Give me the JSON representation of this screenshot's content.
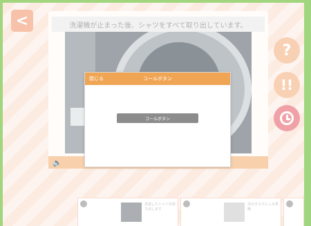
{
  "header": {
    "back_icon": "chevron-left-icon",
    "back_glyph": "<",
    "caption": "洗濯機が止まった後、シャツをすべて取り出しています。"
  },
  "side_buttons": {
    "help_glyph": "?",
    "hint_glyph": "!!",
    "timer_icon": "clock-icon"
  },
  "audio": {
    "speaker_icon": "speaker-icon",
    "speaker_glyph": "🔈"
  },
  "dialog": {
    "close_label": "閉じる",
    "title": "コールボタン",
    "button_label": "コールボタン"
  },
  "thumbnails": [
    {
      "number": "",
      "text": "洗濯したシャツを取り出します"
    },
    {
      "number": "",
      "text": "次のタスクに入る準備"
    },
    {
      "number": "",
      "text": ""
    }
  ],
  "colors": {
    "accent_orange": "#f0a554",
    "alert_pink": "#e86f79",
    "border_green": "#6fc03a"
  }
}
